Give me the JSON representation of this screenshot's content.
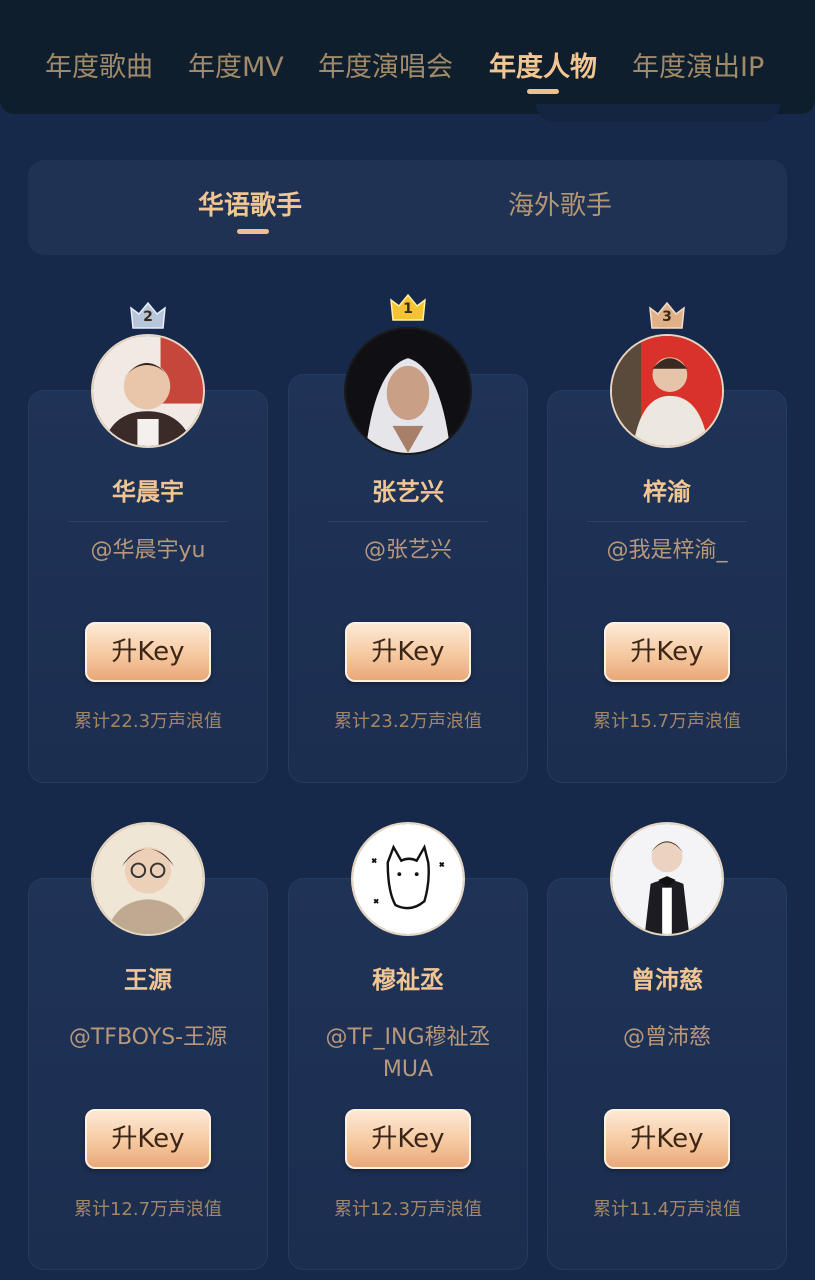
{
  "top_tabs": [
    "年度歌曲",
    "年度MV",
    "年度演唱会",
    "年度人物",
    "年度演出IP"
  ],
  "active_top_tab": "年度人物",
  "sub_tabs": [
    "华语歌手",
    "海外歌手"
  ],
  "active_sub_tab": "华语歌手",
  "cards": [
    {
      "rank": "2",
      "name": "华晨宇",
      "handle": "@华晨宇yu",
      "button": "升Key",
      "score": "累计22.3万声浪值"
    },
    {
      "rank": "1",
      "name": "张艺兴",
      "handle": "@张艺兴",
      "button": "升Key",
      "score": "累计23.2万声浪值"
    },
    {
      "rank": "3",
      "name": "梓渝",
      "handle": "@我是梓渝_",
      "button": "升Key",
      "score": "累计15.7万声浪值"
    },
    {
      "rank": "",
      "name": "王源",
      "handle": "@TFBOYS-王源",
      "button": "升Key",
      "score": "累计12.7万声浪值"
    },
    {
      "rank": "",
      "name": "穆祉丞",
      "handle": "@TF_ING穆祉丞MUA",
      "button": "升Key",
      "score": "累计12.3万声浪值"
    },
    {
      "rank": "",
      "name": "曾沛慈",
      "handle": "@曾沛慈",
      "button": "升Key",
      "score": "累计11.4万声浪值"
    }
  ],
  "colors": {
    "background": "#17294a",
    "accent": "#f2c693",
    "gold_crown": "#f4c430",
    "silver_crown": "#b8c6dc",
    "bronze_crown": "#e0b088"
  }
}
